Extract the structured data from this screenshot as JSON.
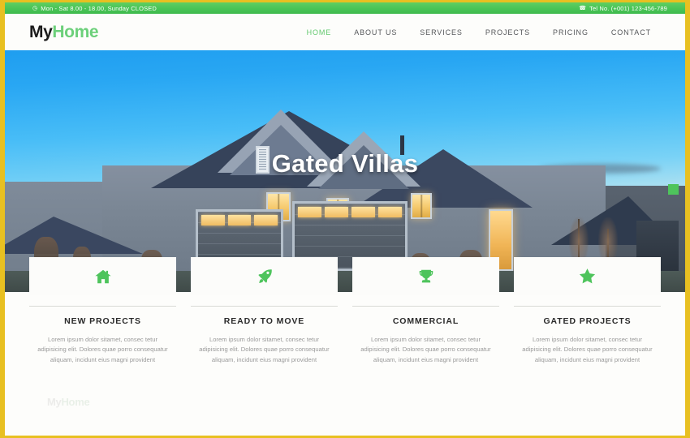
{
  "topbar": {
    "clock_icon": "clock-icon",
    "hours": "Mon - Sat 8.00 - 18.00, Sunday CLOSED",
    "phone_icon": "phone-icon",
    "phone": "Tel No. (+001) 123-456-789",
    "background_color": "#49c456",
    "text_color": "#ffffff"
  },
  "header": {
    "logo_first": "My",
    "logo_second": "Home",
    "logo_first_color": "#1b1b1b",
    "logo_second_color": "#6cd07a",
    "nav": [
      {
        "label": "HOME",
        "active": true
      },
      {
        "label": "ABOUT US",
        "active": false
      },
      {
        "label": "SERVICES",
        "active": false
      },
      {
        "label": "PROJECTS",
        "active": false
      },
      {
        "label": "PRICING",
        "active": false
      },
      {
        "label": "CONTACT",
        "active": false
      }
    ]
  },
  "hero": {
    "title": "Gated Villas",
    "title_color": "#ffffff",
    "image_description": "Suburban two-story house at dusk with blue sky, lit windows and garage doors",
    "slider_button": "slider-next-button",
    "slider_button_color": "#4ec45c"
  },
  "features": [
    {
      "icon": "home-icon",
      "title": "NEW PROJECTS",
      "text": "Lorem ipsum dolor sitamet, consec tetur adipisicing elit. Dolores quae porro consequatur aliquam, incidunt eius magni provident"
    },
    {
      "icon": "rocket-icon",
      "title": "READY TO MOVE",
      "text": "Lorem ipsum dolor sitamet, consec tetur adipisicing elit. Dolores quae porro consequatur aliquam, incidunt eius magni provident"
    },
    {
      "icon": "trophy-icon",
      "title": "COMMERCIAL",
      "text": "Lorem ipsum dolor sitamet, consec tetur adipisicing elit. Dolores quae porro consequatur aliquam, incidunt eius magni provident"
    },
    {
      "icon": "star-icon",
      "title": "GATED PROJECTS",
      "text": "Lorem ipsum dolor sitamet, consec tetur adipisicing elit. Dolores quae porro consequatur aliquam, incidunt eius magni provident"
    }
  ],
  "watermark": {
    "first": "My",
    "second": "Home"
  },
  "theme": {
    "accent_green": "#5ec96c",
    "icon_green": "#4ec45c",
    "frame_yellow": "#e8c021",
    "page_background": "#fdfdfb",
    "muted_text": "#9a9a9a"
  }
}
